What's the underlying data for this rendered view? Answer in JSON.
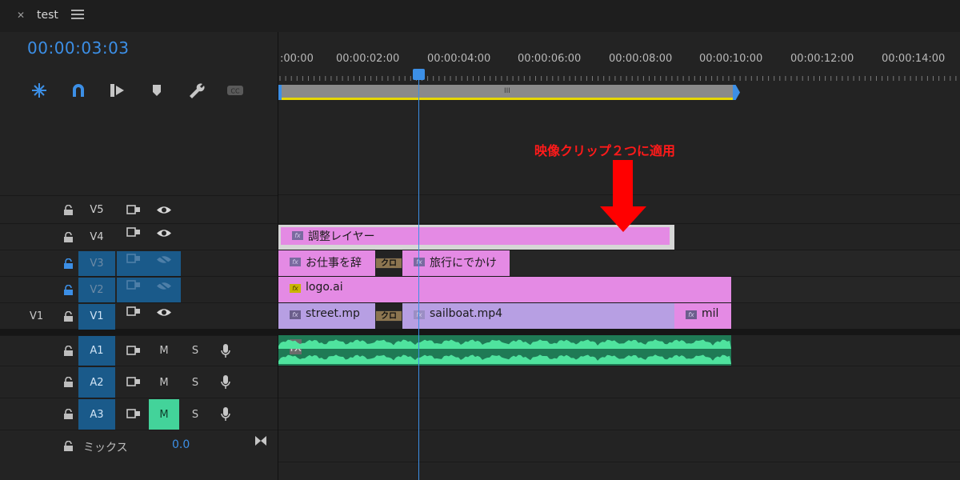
{
  "sequence": {
    "tab_label": "test",
    "timecode": "00:00:03:03"
  },
  "ruler": {
    "labels": [
      ":00:00",
      "00:00:02:00",
      "00:00:04:00",
      "00:00:06:00",
      "00:00:08:00",
      "00:00:10:00",
      "00:00:12:00",
      "00:00:14:00"
    ],
    "workbar_grip": "III"
  },
  "tracks": {
    "video": [
      {
        "name": "V5",
        "target": "",
        "locked": false,
        "visible": true
      },
      {
        "name": "V4",
        "target": "",
        "locked": false,
        "visible": true
      },
      {
        "name": "V3",
        "target": "",
        "locked": true,
        "visible": false
      },
      {
        "name": "V2",
        "target": "",
        "locked": true,
        "visible": false
      },
      {
        "name": "V1",
        "target": "V1",
        "locked": false,
        "visible": true
      }
    ],
    "audio": [
      {
        "name": "A1",
        "mute": "M",
        "solo": "S",
        "mute_on": false
      },
      {
        "name": "A2",
        "mute": "M",
        "solo": "S",
        "mute_on": false
      },
      {
        "name": "A3",
        "mute": "M",
        "solo": "S",
        "mute_on": true
      }
    ],
    "mix": {
      "label": "ミックス",
      "value": "0.0"
    }
  },
  "clips": {
    "adjustment_layer": "調整レイヤー",
    "v3_clip_a": "お仕事を辞",
    "v3_transition": "クロ",
    "v3_clip_b": "旅行にでかけ",
    "v2_clip": "logo.ai",
    "v1_clip_a": "street.mp",
    "v1_transition": "クロ",
    "v1_clip_b": "sailboat.mp4",
    "v1_clip_c": "mil",
    "fx": "fx"
  },
  "annotation": "映像クリップ２つに適用",
  "colors": {
    "accent": "#3c8fe6",
    "adjustment": "#e48ae4",
    "v1_clip": "#b79fe3",
    "audio": "#1f7a55",
    "annotation": "#ff1a1a",
    "mute_on": "#43d39a"
  },
  "icons": [
    "close-icon",
    "panel-menu-icon",
    "snap-icon",
    "magnet-icon",
    "insert-icon",
    "marker-icon",
    "wrench-icon",
    "captions-icon",
    "lock-icon",
    "sync-icon",
    "eye-icon",
    "mic-icon",
    "bowtie-icon"
  ]
}
